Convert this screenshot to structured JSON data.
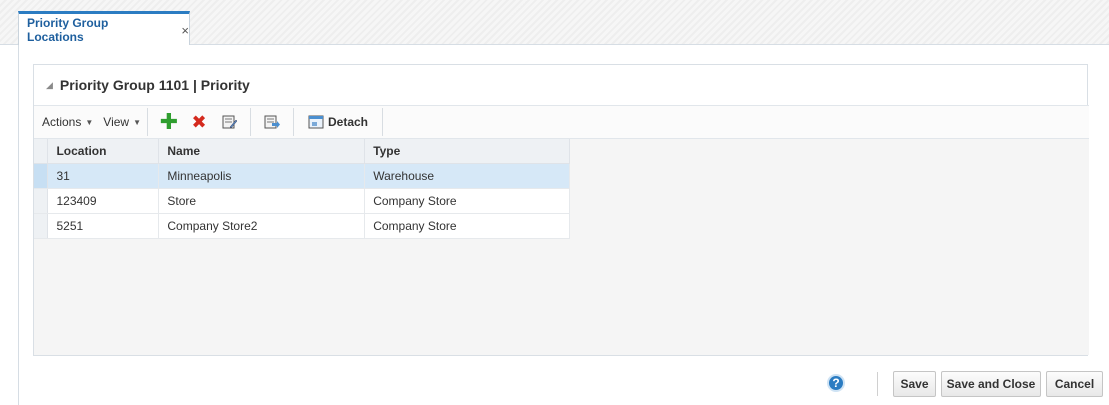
{
  "tab": {
    "label": "Priority Group Locations",
    "close": "×"
  },
  "panel": {
    "title": "Priority Group 1101 |  Priority"
  },
  "toolbar": {
    "actions": "Actions",
    "view": "View",
    "detach": "Detach"
  },
  "table": {
    "columns": [
      "Location",
      "Name",
      "Type"
    ],
    "rows": [
      {
        "location": "31",
        "name": "Minneapolis",
        "type": "Warehouse",
        "selected": true
      },
      {
        "location": "123409",
        "name": "Store",
        "type": "Company Store",
        "selected": false
      },
      {
        "location": "5251",
        "name": "Company Store2",
        "type": "Company Store",
        "selected": false
      }
    ]
  },
  "footer": {
    "help": "?",
    "save": "Save",
    "save_close": "Save and Close",
    "cancel": "Cancel"
  },
  "colors": {
    "accent": "#2b7cc2",
    "selected_row": "#d6e8f7",
    "add": "#2f9e2f",
    "delete": "#d42a1e"
  }
}
